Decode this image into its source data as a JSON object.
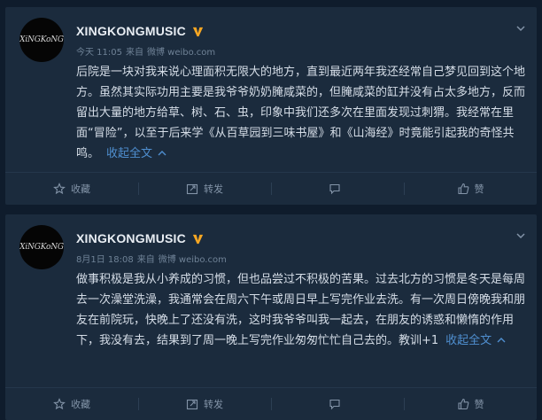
{
  "posts": [
    {
      "avatar_text": "XiNGKoNG",
      "username": "XINGKONGMUSIC",
      "meta": {
        "time": "今天 11:05",
        "from_label": "来自",
        "source": "微博 weibo.com"
      },
      "content": "后院是一块对我来说心理面积无限大的地方，直到最近两年我还经常自己梦见回到这个地方。虽然其实际功用主要是我爷爷奶奶腌咸菜的，但腌咸菜的缸并没有占太多地方，反而留出大量的地方给草、树、石、虫，印象中我们还多次在里面发现过刺猬。我经常在里面“冒险”，以至于后来学《从百草园到三味书屋》和《山海经》时竟能引起我的奇怪共鸣。",
      "collapse_label": "收起全文",
      "actions": {
        "favorite": "收藏",
        "repost": "转发",
        "comment": "",
        "like": "赞"
      }
    },
    {
      "avatar_text": "XiNGKoNG",
      "username": "XINGKONGMUSIC",
      "meta": {
        "time": "8月1日 18:08",
        "from_label": "来自",
        "source": "微博 weibo.com"
      },
      "content": "做事积极是我从小养成的习惯，但也品尝过不积极的苦果。过去北方的习惯是冬天是每周去一次澡堂洗澡，我通常会在周六下午或周日早上写完作业去洗。有一次周日傍晚我和朋友在前院玩，快晚上了还没有洗，这时我爷爷叫我一起去，在朋友的诱惑和懒惰的作用下，我没有去，结果到了周一晚上写完作业匆匆忙忙自己去的。教训+1",
      "collapse_label": "收起全文",
      "actions": {
        "favorite": "收藏",
        "repost": "转发",
        "comment": "",
        "like": "赞"
      }
    }
  ],
  "colors": {
    "background": "#0f1c2c",
    "card": "#1b2b3d",
    "accent": "#4f8fd0",
    "vip_badge": "#f5a623"
  },
  "icons": [
    "chevron-down-icon",
    "verified-v-icon",
    "chevron-up-icon",
    "star-icon",
    "repost-icon",
    "comment-icon",
    "like-icon"
  ]
}
